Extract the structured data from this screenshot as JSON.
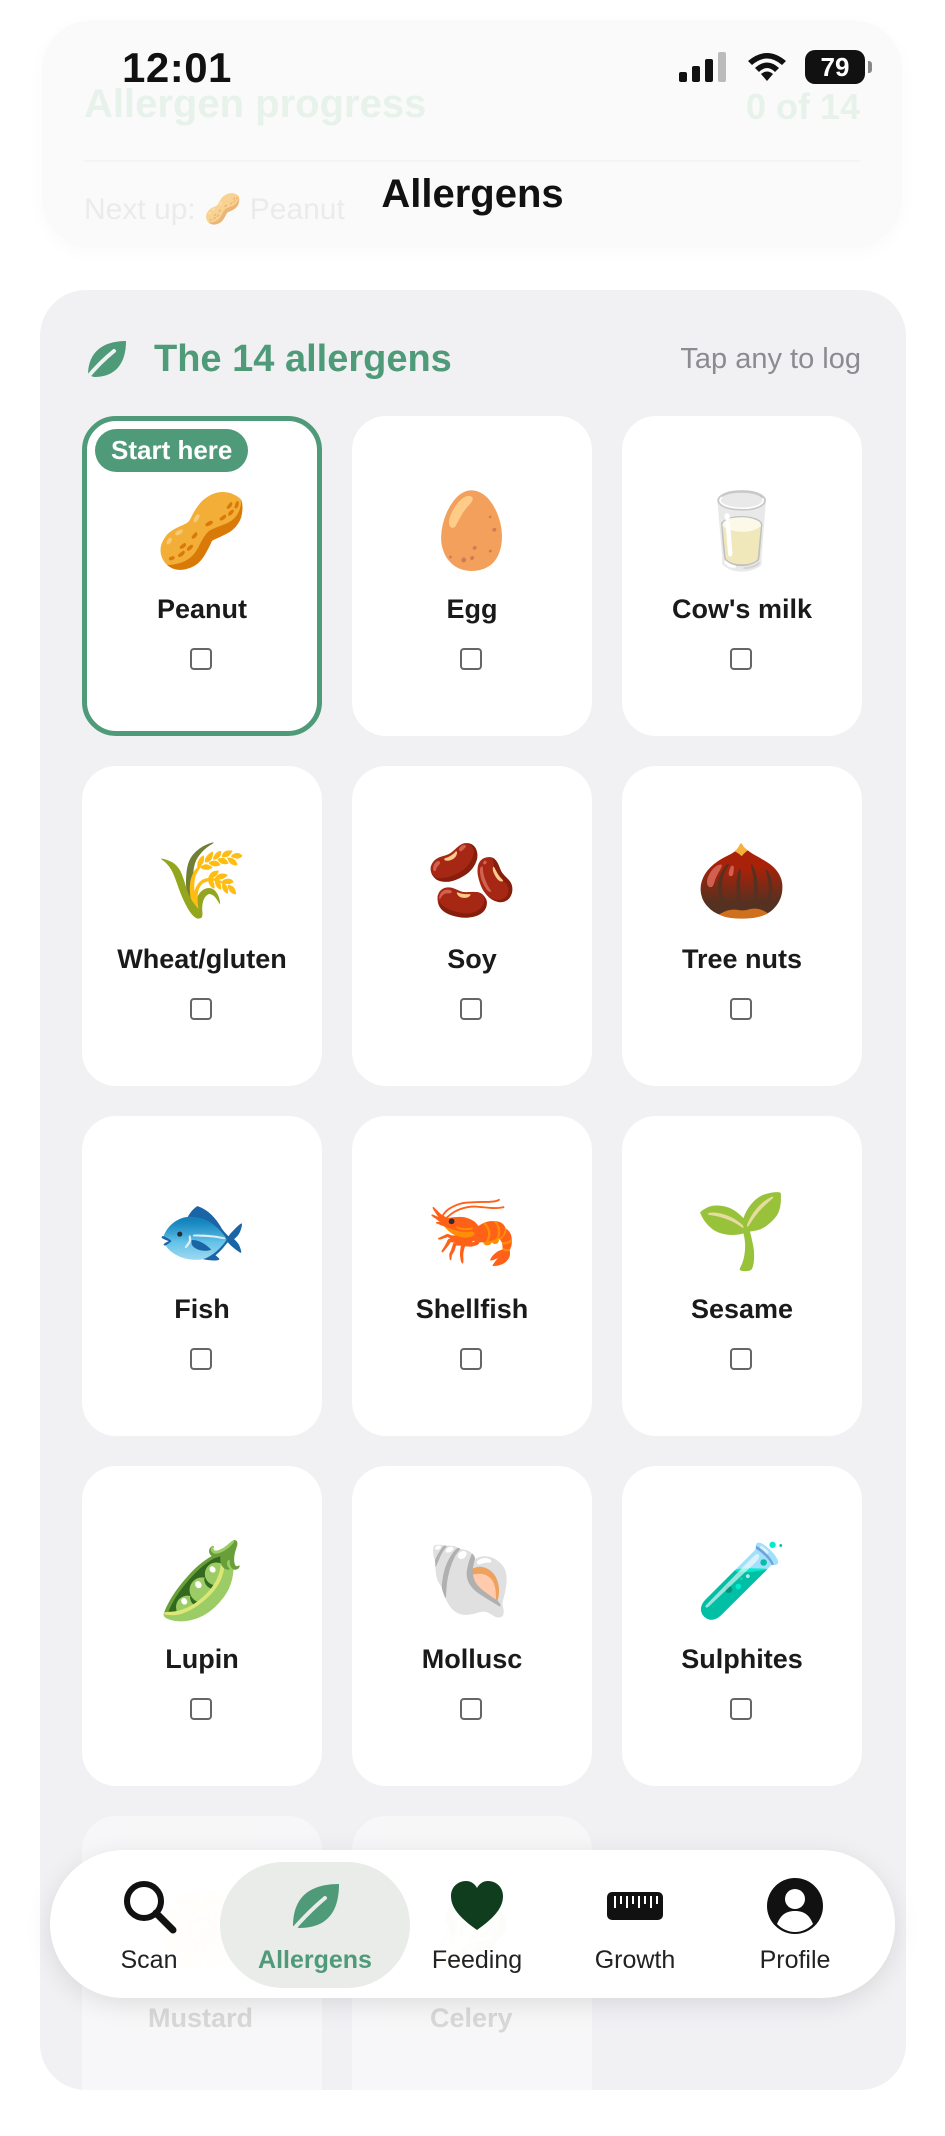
{
  "status_bar": {
    "time": "12:01",
    "battery": "79"
  },
  "progress_card": {
    "title": "Allergen progress",
    "count": "0 of 14",
    "next_up": "Next up: 🥜 Peanut"
  },
  "header": {
    "title": "Allergens"
  },
  "section": {
    "icon": "leaf-icon",
    "title": "The 14 allergens",
    "hint": "Tap any to log"
  },
  "allergens": [
    {
      "label": "Peanut",
      "emoji": "🥜",
      "badge": "Start here",
      "checked": false
    },
    {
      "label": "Egg",
      "emoji": "🥚",
      "checked": false
    },
    {
      "label": "Cow's milk",
      "emoji": "🥛",
      "checked": false
    },
    {
      "label": "Wheat/gluten",
      "emoji": "🌾",
      "checked": false
    },
    {
      "label": "Soy",
      "emoji": "🫘",
      "checked": false
    },
    {
      "label": "Tree nuts",
      "emoji": "🌰",
      "checked": false
    },
    {
      "label": "Fish",
      "emoji": "🐟",
      "checked": false
    },
    {
      "label": "Shellfish",
      "emoji": "🦐",
      "checked": false
    },
    {
      "label": "Sesame",
      "emoji": "🌱",
      "checked": false
    },
    {
      "label": "Lupin",
      "emoji": "🫛",
      "checked": false
    },
    {
      "label": "Mollusc",
      "emoji": "🐚",
      "checked": false
    },
    {
      "label": "Sulphites",
      "emoji": "🧪",
      "checked": false
    },
    {
      "label": "Mustard",
      "emoji": "🌼",
      "checked": false
    },
    {
      "label": "Celery",
      "emoji": "🥬",
      "checked": false
    }
  ],
  "tabbar": {
    "tabs": [
      {
        "label": "Scan",
        "icon": "search-icon"
      },
      {
        "label": "Allergens",
        "icon": "leaf-icon",
        "active": true
      },
      {
        "label": "Feeding",
        "icon": "heart-icon"
      },
      {
        "label": "Growth",
        "icon": "ruler-icon"
      },
      {
        "label": "Profile",
        "icon": "person-icon"
      }
    ]
  },
  "colors": {
    "accent": "#4e9a79",
    "section_bg": "#f1f1f4",
    "card_bg": "#ffffff"
  }
}
